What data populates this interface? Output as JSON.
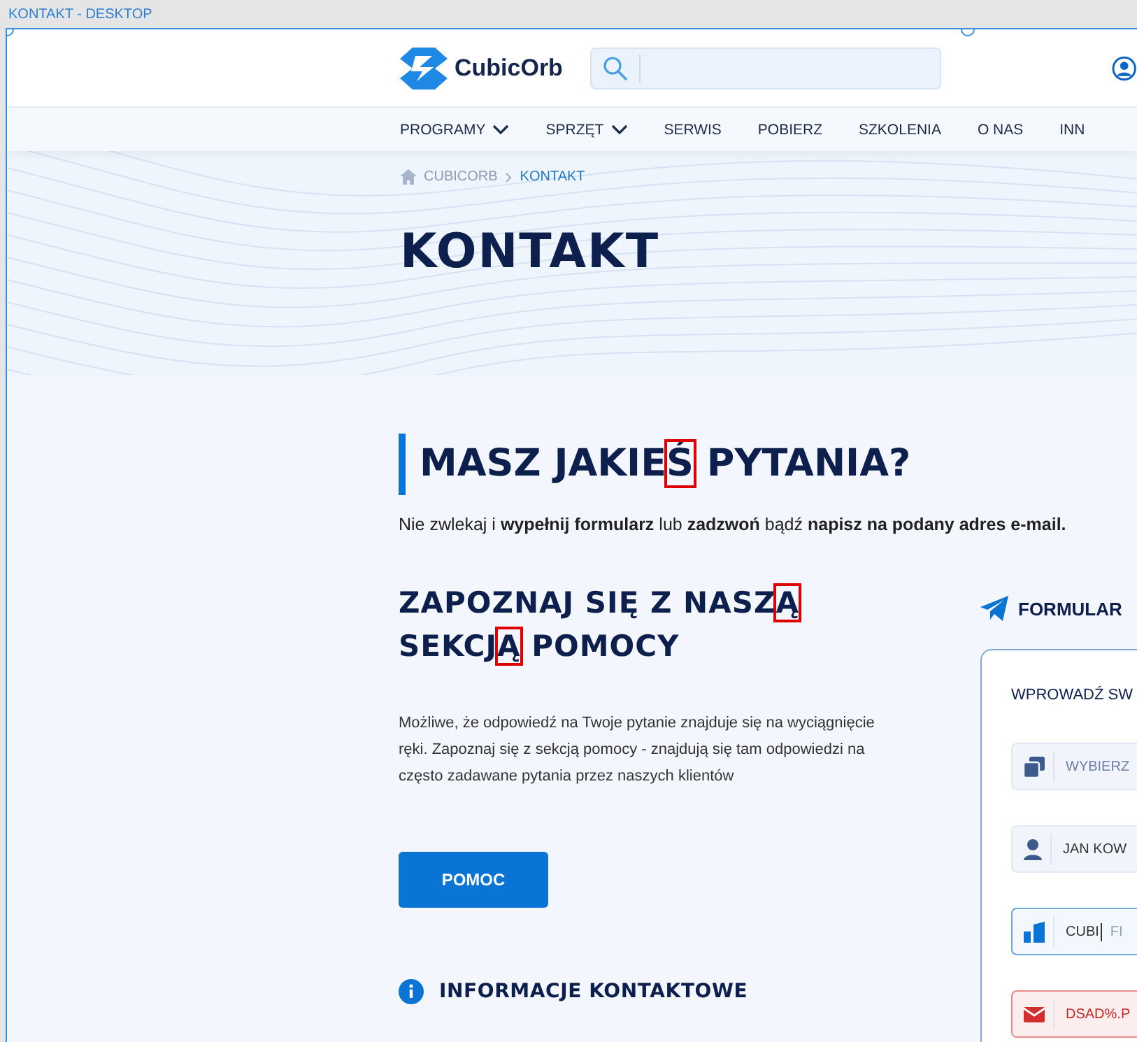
{
  "frame_label": "KONTAKT - DESKTOP",
  "header": {
    "logo_text": "CubicOrb"
  },
  "nav": [
    {
      "label": "PROGRAMY",
      "dropdown": true
    },
    {
      "label": "SPRZĘT",
      "dropdown": true
    },
    {
      "label": "SERWIS",
      "dropdown": false
    },
    {
      "label": "POBIERZ",
      "dropdown": false
    },
    {
      "label": "SZKOLENIA",
      "dropdown": false
    },
    {
      "label": "O NAS",
      "dropdown": false
    },
    {
      "label": "INN",
      "dropdown": false
    }
  ],
  "breadcrumb": [
    {
      "label": "CUBICORB",
      "selected": false
    },
    {
      "label": "KONTAKT",
      "selected": true
    }
  ],
  "hero_title": "KONTAKT",
  "section_heading": [
    {
      "text": "MASZ JAKIE",
      "highlighted": false
    },
    {
      "text": "Ś",
      "highlighted": true
    },
    {
      "text": " PYTANIA?",
      "highlighted": false
    }
  ],
  "intro": "Nie zwlekaj i **wypełnij formularz** lub **zadzwoń** bądź **napisz na podany adres e-mail.**",
  "help": {
    "heading": [
      {
        "text": "ZAPOZNAJ SIĘ Z NASZ",
        "highlighted": false
      },
      {
        "text": "Ą",
        "highlighted": true
      },
      {
        "text": " SEKCJ",
        "highlighted": false
      },
      {
        "text": "Ą",
        "highlighted": true
      },
      {
        "text": " POMOCY",
        "highlighted": false
      }
    ],
    "text": "Możliwe, że odpowiedź na Twoje pytanie znajduje się na wyciągnięcie ręki. Zapoznaj się z sekcją pomocy - znajdują się tam odpowiedzi na często zadawane pytania przez naszych klientów",
    "button": "POMOC"
  },
  "contact_info_heading": "INFORMACJE KONTAKTOWE",
  "form": {
    "title": "FORMULAR",
    "subtitle": "WPROWADŹ SW",
    "fields": [
      {
        "kind": "select",
        "focused": false,
        "invalid": false,
        "placeholder": "WYBIERZ"
      },
      {
        "kind": "name",
        "focused": false,
        "invalid": false,
        "value": "JAN KOW"
      },
      {
        "kind": "company",
        "focused": true,
        "invalid": false,
        "value": "CUBI",
        "hint": "FI"
      },
      {
        "kind": "email",
        "focused": false,
        "invalid": true,
        "value": "DSAD%.P"
      }
    ]
  }
}
